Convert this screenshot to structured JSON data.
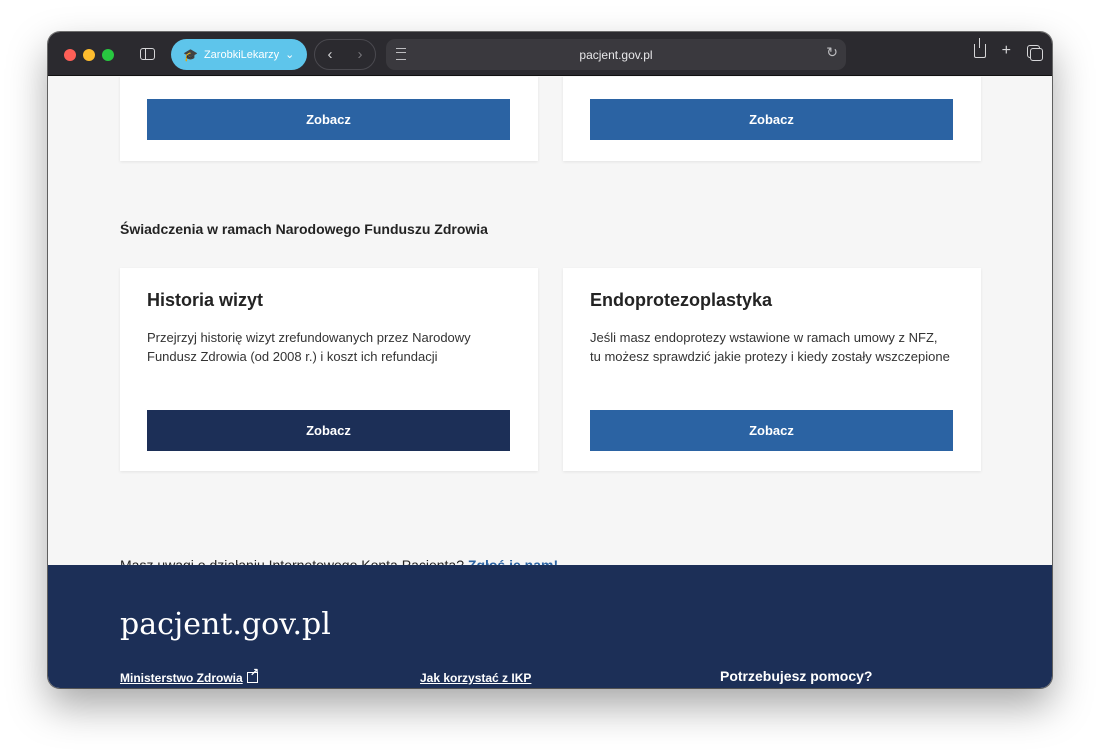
{
  "browser": {
    "profile_label": "ZarobkiLekarzy",
    "url": "pacjent.gov.pl"
  },
  "top_cards": {
    "left_button": "Zobacz",
    "right_button": "Zobacz"
  },
  "section": {
    "heading": "Świadczenia w ramach Narodowego Funduszu Zdrowia"
  },
  "cards": [
    {
      "title": "Historia wizyt",
      "description": "Przejrzyj historię wizyt zrefundowanych przez Narodowy Fundusz Zdrowia (od 2008 r.) i koszt ich refundacji",
      "button": "Zobacz"
    },
    {
      "title": "Endoprotezoplastyka",
      "description": "Jeśli masz endoprotezy wstawione w ramach umowy z NFZ, tu możesz sprawdzić jakie protezy i kiedy zostały wszczepione",
      "button": "Zobacz"
    }
  ],
  "feedback": {
    "text": "Masz uwagi o działaniu Internetowego Konta Pacjenta?",
    "link": "Zgłoś je nam!"
  },
  "footer": {
    "logo": "pacjent.gov.pl",
    "links": [
      "Ministerstwo Zdrowia",
      "Jak korzystać z IKP"
    ],
    "help_heading": "Potrzebujesz pomocy?"
  },
  "colors": {
    "primary_blue": "#2b63a3",
    "navy": "#1c2f57",
    "profile_pill": "#5ec5eb"
  }
}
